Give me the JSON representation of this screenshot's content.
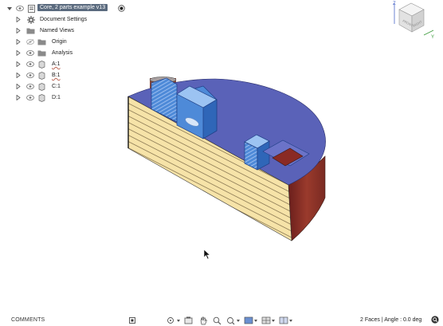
{
  "browser": {
    "root": {
      "label": "Core, 2 parts example v13"
    },
    "items": [
      {
        "label": "Document Settings",
        "icon": "gear-icon"
      },
      {
        "label": "Named Views",
        "icon": "folder-icon"
      },
      {
        "label": "Origin",
        "icon": "folder-icon"
      },
      {
        "label": "Analysis",
        "icon": "folder-icon"
      },
      {
        "label": "A:1",
        "icon": "component-icon"
      },
      {
        "label": "B:1",
        "icon": "component-icon"
      },
      {
        "label": "C:1",
        "icon": "component-icon"
      },
      {
        "label": "D:1",
        "icon": "component-icon"
      }
    ]
  },
  "viewcube": {
    "faces": [
      "FRONT",
      "RIGHT"
    ],
    "axes": [
      "Z",
      "Y"
    ]
  },
  "bottom": {
    "comments_label": "COMMENTS",
    "status_text": "2 Faces | Angle : 0.0 deg",
    "toolbar": [
      "orbit-icon",
      "look-at-icon",
      "pan-icon",
      "zoom-icon",
      "fit-icon",
      "display-settings-icon",
      "grid-icon",
      "viewports-icon"
    ]
  },
  "colors": {
    "top_face": "#5a62b8",
    "layer_face": "#f6e3a8",
    "curved_face": "#7a2a22",
    "selected_blue": "#3b7fd6",
    "root_label_bg": "#5a6a7e"
  }
}
